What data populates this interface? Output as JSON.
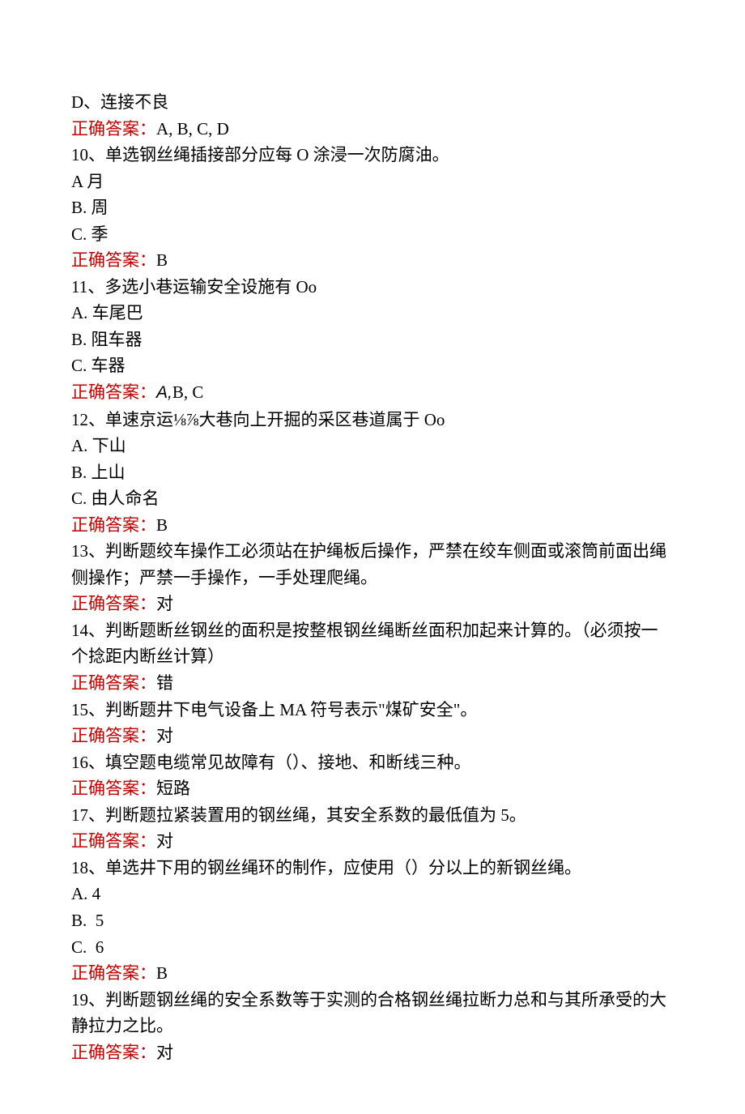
{
  "lines": {
    "l0": "D、连接不良",
    "l1_label": "正确答案：",
    "l1_val": "A, B, C, D",
    "l2": "10、单选钢丝绳插接部分应每 O 涂浸一次防腐油。",
    "l3": "A 月",
    "l4": "B. 周",
    "l5": "C. 季",
    "l6_label": "正确答案：",
    "l6_val": "B",
    "l7": "11、多选小巷运输安全设施有 Oo",
    "l8": "A. 车尾巴",
    "l9": "B. 阻车器",
    "l10": "C. 车器",
    "l11_label": "正确答案：",
    "l11_val_a": "A,",
    "l11_val_b": "B, C",
    "l12": "12、单速京运⅛⅞大巷向上开掘的采区巷道属于 Oo",
    "l13": "A. 下山",
    "l14": "B. 上山",
    "l15": "C. 由人命名",
    "l16_label": "正确答案：",
    "l16_val": "B",
    "l17": "13、判断题绞车操作工必须站在护绳板后操作，严禁在绞车侧面或滚筒前面出绳侧操作；严禁一手操作，一手处理爬绳。",
    "l18_label": "正确答案：",
    "l18_val": "对",
    "l19": "14、判断题断丝钢丝的面积是按整根钢丝绳断丝面积加起来计算的。（必须按一个捻距内断丝计算）",
    "l20_label": "正确答案：",
    "l20_val": "错",
    "l21": "15、判断题井下电气设备上 MA 符号表示\"煤矿安全\"。",
    "l22_label": "正确答案：",
    "l22_val": "对",
    "l23": "16、填空题电缆常见故障有（）、接地、和断线三种。",
    "l24_label": "正确答案：",
    "l24_val": "短路",
    "l25": "17、判断题拉紧装置用的钢丝绳，其安全系数的最低值为 5。",
    "l26_label": "正确答案：",
    "l26_val": "对",
    "l27": "18、单选井下用的钢丝绳环的制作，应使用（）分以上的新钢丝绳。",
    "l28": "A. 4",
    "l29": "B.  5",
    "l30": "C.  6",
    "l31_label": "正确答案：",
    "l31_val": "B",
    "l32": "19、判断题钢丝绳的安全系数等于实测的合格钢丝绳拉断力总和与其所承受的大静拉力之比。",
    "l33_label": "正确答案：",
    "l33_val": "对"
  }
}
